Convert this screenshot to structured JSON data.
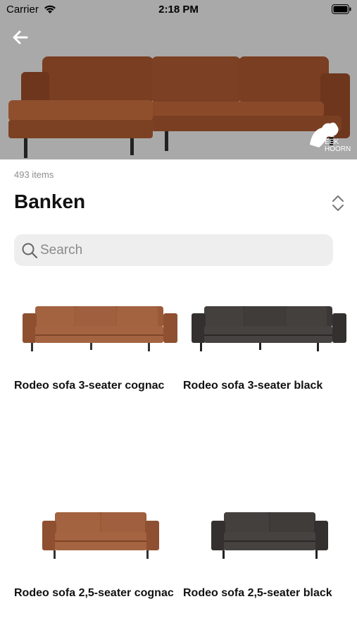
{
  "status_bar": {
    "carrier": "Carrier",
    "time": "2:18 PM"
  },
  "hero": {
    "image_subject": "leather corner sofa cognac",
    "brand_logo_lines": [
      "DE",
      "EEK",
      "HOORN"
    ]
  },
  "header": {
    "item_count": "493 items",
    "title": "Banken"
  },
  "search": {
    "placeholder": "Search",
    "value": ""
  },
  "products": [
    {
      "name": "Rodeo sofa 3-seater cognac",
      "color": "#a0603a"
    },
    {
      "name": "Rodeo sofa 3-seater black",
      "color": "#3e3a38"
    },
    {
      "name": "Rodeo sofa 2,5-seater cognac",
      "color": "#a0603a"
    },
    {
      "name": "Rodeo sofa 2,5-seater black",
      "color": "#3e3a38"
    }
  ],
  "colors": {
    "hero_background": "#a9a9a9",
    "search_background": "#eeeeee",
    "muted_text": "#8e8e8e"
  }
}
